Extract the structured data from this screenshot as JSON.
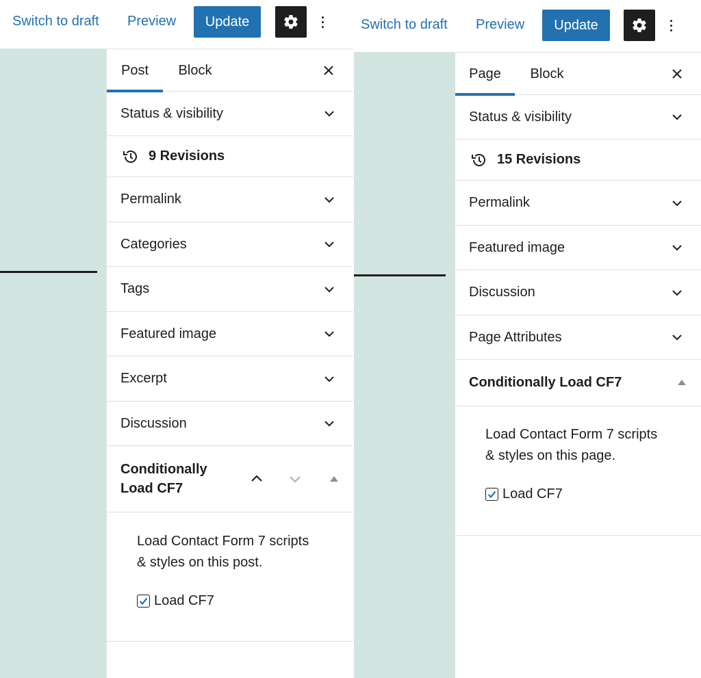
{
  "left": {
    "toolbar": {
      "switch_to_draft": "Switch to draft",
      "preview": "Preview",
      "update": "Update",
      "settings_icon": "gear-icon",
      "more_icon": "vertical-ellipsis-icon"
    },
    "tabs": [
      "Post",
      "Block"
    ],
    "active_tab": "Post",
    "close_icon": "close-icon",
    "panels": {
      "status": "Status & visibility",
      "revisions": "9 Revisions",
      "permalink": "Permalink",
      "categories": "Categories",
      "tags": "Tags",
      "featured_image": "Featured image",
      "excerpt": "Excerpt",
      "discussion": "Discussion"
    },
    "cf7": {
      "title_line1": "Conditionally",
      "title_line2": "Load CF7",
      "description_line1": "Load Contact Form 7 scripts",
      "description_line2": "& styles on this post.",
      "checkbox_label": "Load CF7",
      "checked": true
    }
  },
  "right": {
    "toolbar": {
      "switch_to_draft": "Switch to draft",
      "preview": "Preview",
      "update": "Update",
      "settings_icon": "gear-icon",
      "more_icon": "vertical-ellipsis-icon"
    },
    "tabs": [
      "Page",
      "Block"
    ],
    "active_tab": "Page",
    "close_icon": "close-icon",
    "panels": {
      "status": "Status & visibility",
      "revisions": "15 Revisions",
      "permalink": "Permalink",
      "featured_image": "Featured image",
      "discussion": "Discussion",
      "page_attributes": "Page Attributes"
    },
    "cf7": {
      "title": "Conditionally Load CF7",
      "description_line1": "Load Contact Form 7 scripts",
      "description_line2": "& styles on this page.",
      "checkbox_label": "Load CF7",
      "checked": true
    }
  },
  "colors": {
    "accent": "#2271b1",
    "canvas": "#d3e5e0",
    "dark": "#1e1e1e",
    "border": "#e0e0e0"
  }
}
